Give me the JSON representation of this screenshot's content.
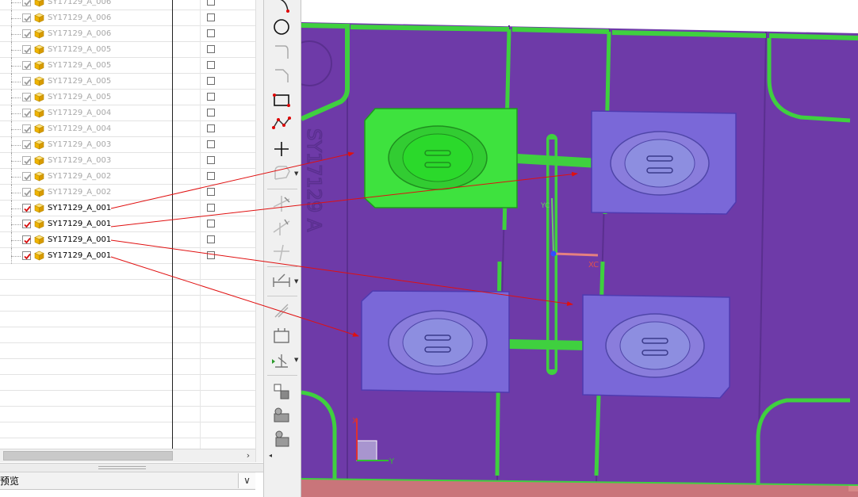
{
  "navigator": {
    "rows": [
      {
        "name": "SY17129_A_006",
        "checked": false,
        "active": false
      },
      {
        "name": "SY17129_A_006",
        "checked": false,
        "active": false
      },
      {
        "name": "SY17129_A_006",
        "checked": false,
        "active": false
      },
      {
        "name": "SY17129_A_005",
        "checked": false,
        "active": false
      },
      {
        "name": "SY17129_A_005",
        "checked": false,
        "active": false
      },
      {
        "name": "SY17129_A_005",
        "checked": false,
        "active": false
      },
      {
        "name": "SY17129_A_005",
        "checked": false,
        "active": false
      },
      {
        "name": "SY17129_A_004",
        "checked": false,
        "active": false
      },
      {
        "name": "SY17129_A_004",
        "checked": false,
        "active": false
      },
      {
        "name": "SY17129_A_003",
        "checked": false,
        "active": false
      },
      {
        "name": "SY17129_A_003",
        "checked": false,
        "active": false
      },
      {
        "name": "SY17129_A_002",
        "checked": false,
        "active": false
      },
      {
        "name": "SY17129_A_002",
        "checked": false,
        "active": false
      },
      {
        "name": "SY17129_A_001",
        "checked": true,
        "active": true
      },
      {
        "name": "SY17129_A_001",
        "checked": true,
        "active": true
      },
      {
        "name": "SY17129_A_001",
        "checked": true,
        "active": true
      },
      {
        "name": "SY17129_A_001",
        "checked": true,
        "active": true
      }
    ],
    "scroll_arrow": "›"
  },
  "preview": {
    "label": "预览",
    "toggle_glyph": "∨"
  },
  "toolbar": {
    "tools": [
      "arc-icon",
      "circle-icon",
      "fillet-icon",
      "chamfer-icon",
      "rectangle-icon",
      "polyline-icon",
      "point-icon",
      "offset-curve-icon",
      "trim-icon",
      "extend-icon",
      "corner-icon",
      "rapid-dimension-icon",
      "constraint-icon",
      "display-constraints-icon",
      "convert-icon",
      "alternate-solution-icon",
      "inferred-constraints-icon",
      "create-sketch-icon",
      "sketch-settings-icon",
      "reattach-icon"
    ]
  },
  "viewport": {
    "colors": {
      "plate": "#6e3aa8",
      "plate_dark": "#5a2f8f",
      "edge_green": "#3fd03f",
      "selected_cavity": "#3ee23e",
      "cavity": "#7a68d8",
      "floor": "#c9757a",
      "annotation": "#e01010"
    },
    "wcs_labels": {
      "xc": "XC",
      "yc": "YC"
    },
    "triad_labels": {
      "x": "X",
      "y": "Y"
    },
    "engraving": "SY17129 A"
  }
}
